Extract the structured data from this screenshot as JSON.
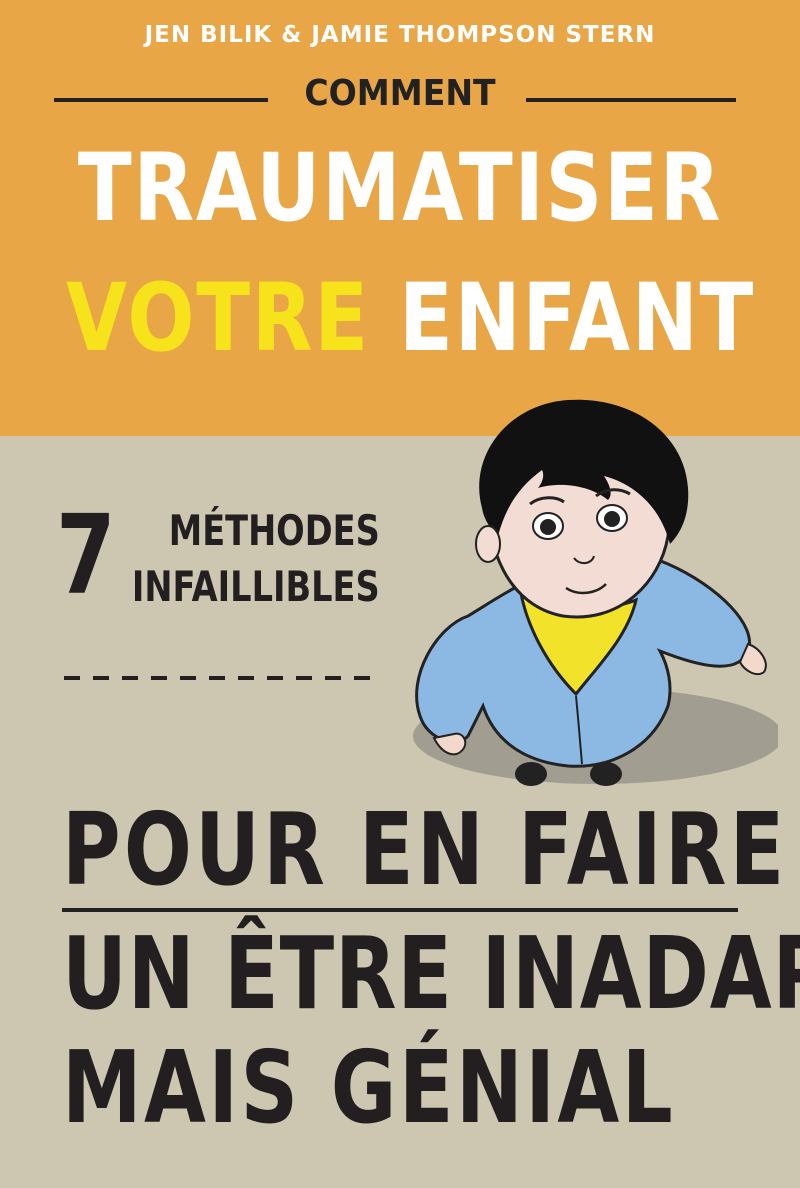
{
  "cover": {
    "authors": "JEN BILIK & JAMIE THOMPSON STERN",
    "title_small": "COMMENT",
    "title_line1": "TRAUMATISER",
    "title_line2_word1": "VOTRE",
    "title_line2_word2": "ENFANT",
    "count": "7",
    "methods_line1": "MÉTHODES",
    "methods_line2": "INFAILLIBLES",
    "subtitle_line1": "POUR EN FAIRE",
    "subtitle_line2": "UN ÊTRE INADAPTÉ",
    "subtitle_line3": "MAIS GÉNIAL"
  },
  "colors": {
    "top_band": "#e8a646",
    "bottom_band": "#cdc7b2",
    "highlight_yellow": "#f7e31b",
    "ink": "#231f20",
    "sweater_blue": "#8cb9e3",
    "shirt_yellow": "#f3e22a"
  },
  "illustration": "child-from-above"
}
